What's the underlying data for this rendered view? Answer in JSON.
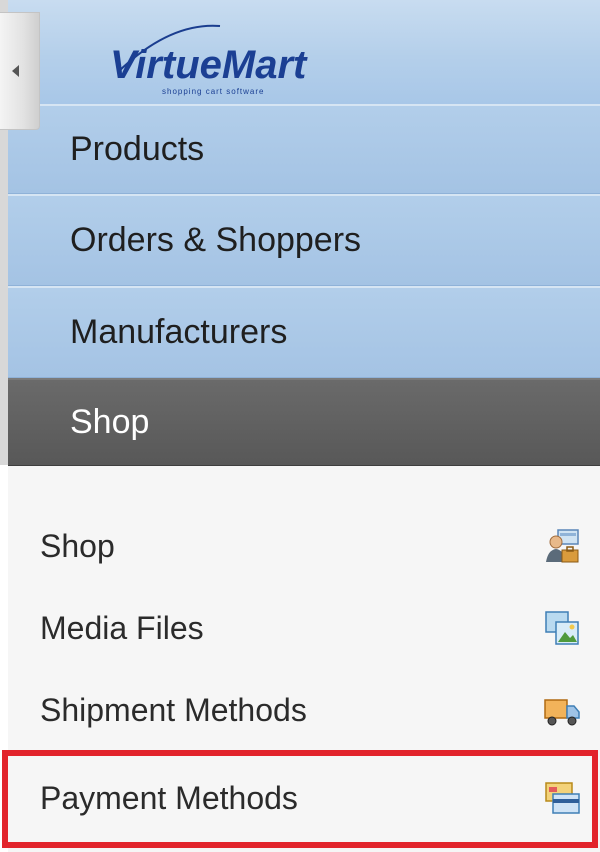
{
  "logo": {
    "text": "VirtueMart",
    "tagline": "shopping cart software"
  },
  "nav": {
    "items": [
      {
        "label": "Products",
        "active": false
      },
      {
        "label": "Orders & Shoppers",
        "active": false
      },
      {
        "label": "Manufacturers",
        "active": false
      },
      {
        "label": "Shop",
        "active": true
      }
    ]
  },
  "submenu": {
    "items": [
      {
        "label": "Shop",
        "icon": "shop-person-icon"
      },
      {
        "label": "Media Files",
        "icon": "media-files-icon"
      },
      {
        "label": "Shipment Methods",
        "icon": "truck-icon"
      },
      {
        "label": "Payment Methods",
        "icon": "credit-card-icon"
      }
    ]
  },
  "colors": {
    "nav_blue": "#a8c7e8",
    "active_gray": "#5e5e5e",
    "highlight_red": "#e2242c"
  }
}
